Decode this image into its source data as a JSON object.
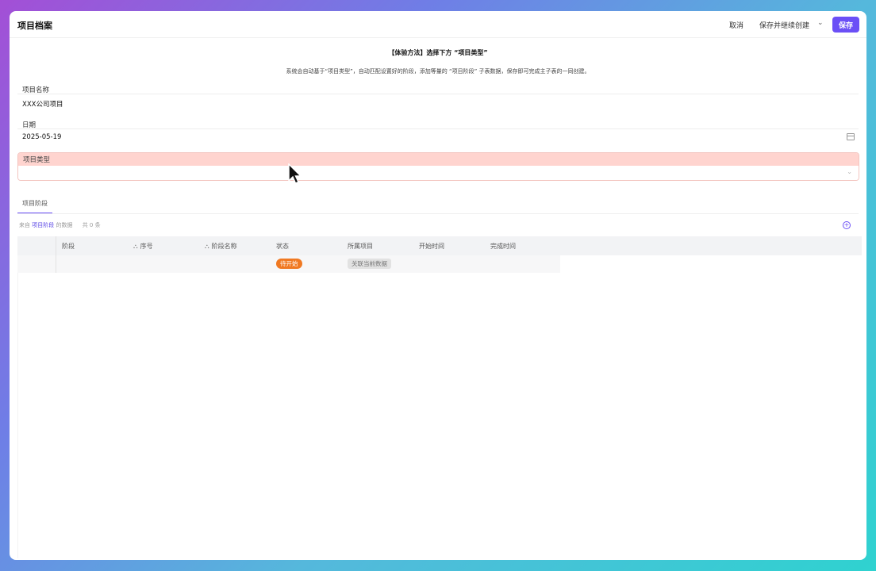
{
  "header": {
    "title": "项目档案",
    "cancel_label": "取消",
    "save_continue_label": "保存并继续创建",
    "save_label": "保存"
  },
  "intro": {
    "title": "【体验方法】选择下方 “项目类型”",
    "description": "系统会自动基于“项目类型”，自动匹配设置好的阶段，添加等量的 “项目阶段” 子表数据，保存即可完成主子表的一同创建。"
  },
  "fields": {
    "name": {
      "label": "项目名称",
      "value": "XXX公司项目"
    },
    "date": {
      "label": "日期",
      "value": "2025-05-19"
    },
    "type": {
      "label": "项目类型",
      "value": ""
    }
  },
  "tabs": [
    {
      "label": "项目阶段"
    }
  ],
  "subtable": {
    "info_prefix": "来自",
    "info_link": "项目阶段",
    "info_suffix": "的数据",
    "count": "共 0 条",
    "columns": [
      "阶段",
      "序号",
      "阶段名称",
      "状态",
      "所属项目",
      "开始时间",
      "完成时间"
    ],
    "row": {
      "status": "待开始",
      "project": "关联当前数据"
    }
  },
  "colors": {
    "accent": "#6b4ff6",
    "status_orange": "#f07922",
    "required_bg": "#ffd4cf"
  },
  "icons": [
    "chevron-down-icon",
    "calendar-icon",
    "tree-icon",
    "add-circle-icon",
    "cursor-icon"
  ]
}
